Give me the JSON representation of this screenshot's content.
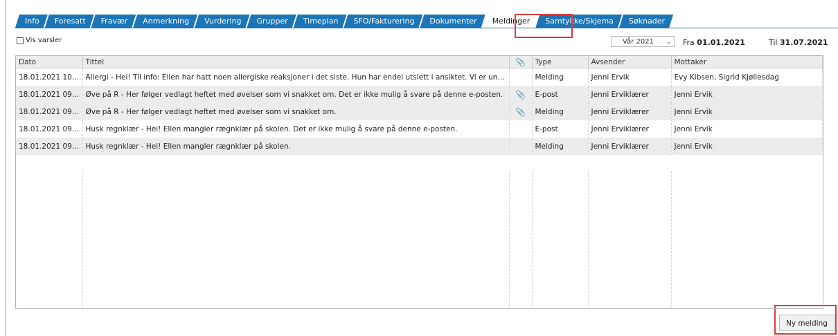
{
  "tabs": [
    {
      "label": "Info"
    },
    {
      "label": "Foresatt"
    },
    {
      "label": "Fravær"
    },
    {
      "label": "Anmerkning"
    },
    {
      "label": "Vurdering"
    },
    {
      "label": "Grupper"
    },
    {
      "label": "Timeplan"
    },
    {
      "label": "SFO/Fakturering"
    },
    {
      "label": "Dokumenter"
    },
    {
      "label": "Meldinger"
    },
    {
      "label": "Samtykke/Skjema"
    },
    {
      "label": "Søknader"
    }
  ],
  "filters": {
    "vis_varsler_label": "Vis varsler",
    "term_value": "Vår 2021",
    "fra_label": "Fra",
    "fra_date": "01.01.2021",
    "til_label": "Til",
    "til_date": "31.07.2021"
  },
  "table": {
    "columns": [
      "Dato",
      "Tittel",
      "attachment-icon",
      "Type",
      "Avsender",
      "Mottaker"
    ],
    "col_labels": {
      "dato": "Dato",
      "tittel": "Tittel",
      "type": "Type",
      "avsender": "Avsender",
      "mottaker": "Mottaker"
    },
    "rows": [
      {
        "dato": "18.01.2021 10:...",
        "tittel": "Allergi - Hei! Til info: Ellen har hatt noen allergiske reaksjoner i det siste. Hun har endel utslett i ansiktet. Vi er und...",
        "attachment": false,
        "type": "Melding",
        "avsender": "Jenni Ervik",
        "mottaker": "Evy Kibsen, Sigrid Kjøllesdag"
      },
      {
        "dato": "18.01.2021 09:...",
        "tittel": "Øve på R - Her følger vedlagt heftet med øvelser som vi snakket om. Det er ikke mulig å svare på denne e-posten.",
        "attachment": true,
        "type": "E-post",
        "avsender": "Jenni Erviklærer",
        "mottaker": "Jenni Ervik"
      },
      {
        "dato": "18.01.2021 09:...",
        "tittel": "Øve på R - Her følger vedlagt heftet med øvelser som vi snakket om.",
        "attachment": true,
        "type": "Melding",
        "avsender": "Jenni Erviklærer",
        "mottaker": "Jenni Ervik"
      },
      {
        "dato": "18.01.2021 09:...",
        "tittel": "Husk regnklær - Hei! Ellen mangler rægnklær på skolen. Det er ikke mulig å svare på denne e-posten.",
        "attachment": false,
        "type": "E-post",
        "avsender": "Jenni Erviklærer",
        "mottaker": "Jenni Ervik"
      },
      {
        "dato": "18.01.2021 09:...",
        "tittel": "Husk regnklær - Hei! Ellen mangler rægnklær på skolen.",
        "attachment": false,
        "type": "Melding",
        "avsender": "Jenni Erviklærer",
        "mottaker": "Jenni Ervik"
      }
    ]
  },
  "actions": {
    "new_message_label": "Ny melding"
  },
  "colors": {
    "tab_blue": "#1b75b6",
    "highlight_red": "#e03a3a",
    "row_alt": "#ececec"
  }
}
